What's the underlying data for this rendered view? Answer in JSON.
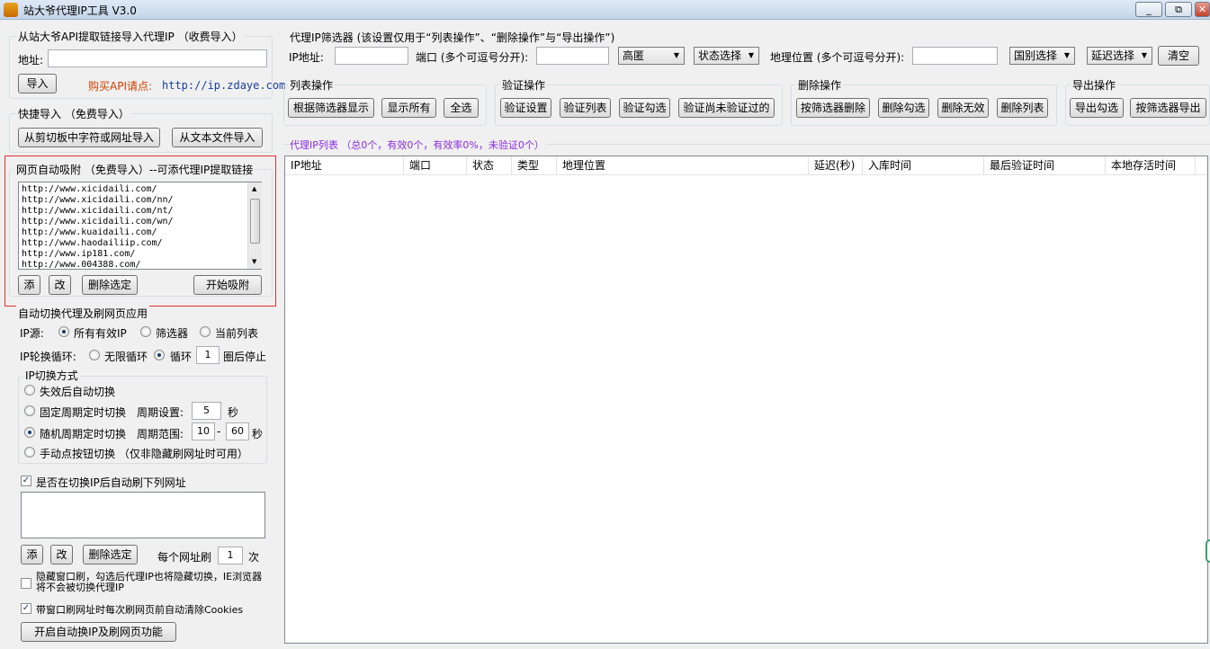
{
  "window": {
    "title": "站大爷代理IP工具 V3.0",
    "min": "▭",
    "restore": "⧉",
    "close": "✕"
  },
  "api_import": {
    "legend": "从站大爷API提取链接导入代理IP （收费导入）",
    "address_label": "地址:",
    "address_value": "",
    "import_btn": "导入",
    "buy_text": "购买API请点:",
    "buy_url": "http://ip.zdaye.com"
  },
  "quick_import": {
    "legend": "快捷导入 （免费导入）",
    "clipboard_btn": "从剪切板中字符或网址导入",
    "file_btn": "从文本文件导入"
  },
  "web_adsorb": {
    "legend": "网页自动吸附 （免费导入）--可添代理IP提取链接",
    "urls": [
      "http://www.xicidaili.com/",
      "http://www.xicidaili.com/nn/",
      "http://www.xicidaili.com/nt/",
      "http://www.xicidaili.com/wn/",
      "http://www.kuaidaili.com/",
      "http://www.haodailiip.com/",
      "http://www.ip181.com/",
      "http://www.004388.com/"
    ],
    "add_btn": "添",
    "edit_btn": "改",
    "delete_btn": "删除选定",
    "start_btn": "开始吸附"
  },
  "auto_switch": {
    "legend": "自动切换代理及刷网页应用",
    "ip_source_label": "IP源:",
    "ip_source_options": [
      "所有有效IP",
      "筛选器",
      "当前列表"
    ],
    "ip_source_selected": 0,
    "rotation_label": "IP轮换循环:",
    "rotation_infinite": "无限循环",
    "rotation_loop": "循环",
    "rotation_count": "1",
    "rotation_suffix": "圈后停止",
    "switch_mode_legend": "IP切换方式",
    "mode_fail": "失效后自动切换",
    "mode_fixed": "固定周期定时切换",
    "period_label": "周期设置:",
    "period_value": "5",
    "sec": "秒",
    "mode_random": "随机周期定时切换",
    "range_label": "周期范围:",
    "range_min": "10",
    "range_dash": "-",
    "range_max": "60",
    "mode_manual": "手动点按钮切换 （仅非隐藏刷网址时可用）",
    "refresh_check": "是否在切换IP后自动刷下列网址",
    "refresh_add": "添",
    "refresh_edit": "改",
    "refresh_delete": "删除选定",
    "per_url_label": "每个网址刷",
    "per_url_value": "1",
    "per_url_suffix": "次",
    "hide_window": "隐藏窗口刷，勾选后代理IP也将隐藏切换，IE浏览器将不会被切换代理IP",
    "clear_cookies": "带窗口刷网址时每次刷网页前自动清除Cookies",
    "start_btn": "开启自动换IP及刷网页功能"
  },
  "filter": {
    "legend": "代理IP筛选器 (该设置仅用于“列表操作”、“删除操作”与“导出操作”)",
    "ip_label": "IP地址:",
    "port_label": "端口 (多个可逗号分开):",
    "anon_select": "高匿",
    "status_select": "状态选择",
    "geo_label": "地理位置 (多个可逗号分开):",
    "country_select": "国别选择",
    "delay_select": "延迟选择",
    "clear_btn": "清空"
  },
  "list_ops": {
    "legend": "列表操作",
    "buttons": [
      "根据筛选器显示",
      "显示所有",
      "全选"
    ]
  },
  "verify_ops": {
    "legend": "验证操作",
    "buttons": [
      "验证设置",
      "验证列表",
      "验证勾选",
      "验证尚未验证过的"
    ]
  },
  "delete_ops": {
    "legend": "删除操作",
    "buttons": [
      "按筛选器删除",
      "删除勾选",
      "删除无效",
      "删除列表"
    ]
  },
  "export_ops": {
    "legend": "导出操作",
    "buttons": [
      "导出勾选",
      "按筛选器导出"
    ]
  },
  "proxy_list": {
    "caption": "代理IP列表 （总0个，有效0个，有效率0%，未验证0个）",
    "columns": [
      "IP地址",
      "端口",
      "状态",
      "类型",
      "地理位置",
      "延迟(秒)",
      "入库时间",
      "最后验证时间",
      "本地存活时间"
    ]
  },
  "colors": {
    "accent_purple": "#8a2be2",
    "buy_text": "#d04000",
    "highlight_border": "#e03030"
  }
}
